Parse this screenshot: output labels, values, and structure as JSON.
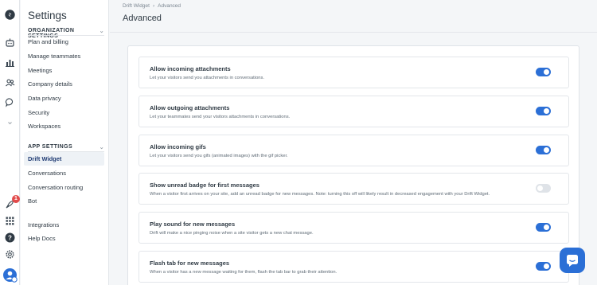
{
  "rail": {
    "icons": [
      "drift-logo-icon",
      "bot-icon",
      "reports-icon",
      "contacts-icon",
      "conversations-icon",
      "more-chevron-icon",
      "rocket-icon",
      "apps-grid-icon",
      "help-icon",
      "settings-icon",
      "avatar-icon"
    ],
    "badge_count": "1"
  },
  "sidebar": {
    "title": "Settings",
    "org_header": "ORGANIZATION SETTINGS",
    "org_items": [
      "Plan and billing",
      "Manage teammates",
      "Meetings",
      "Company details",
      "Data privacy",
      "Security",
      "Workspaces"
    ],
    "app_header": "APP SETTINGS",
    "app_items": [
      "Drift Widget",
      "Conversations",
      "Conversation routing",
      "Bot"
    ],
    "other_items": [
      "Integrations",
      "Help Docs"
    ],
    "active_item": "Drift Widget"
  },
  "breadcrumb": {
    "parent": "Drift Widget",
    "current": "Advanced"
  },
  "page_title": "Advanced",
  "settings": [
    {
      "title": "Allow incoming attachments",
      "desc": "Let your visitors send you attachments in conversations.",
      "enabled": true
    },
    {
      "title": "Allow outgoing attachments",
      "desc": "Let your teammates send your visitors attachments in conversations.",
      "enabled": true
    },
    {
      "title": "Allow incoming gifs",
      "desc": "Let your visitors send you gifs (animated images) with the gif picker.",
      "enabled": true
    },
    {
      "title": "Show unread badge for first messages",
      "desc": "When a visitor first arrives on your site, add an unread badge for new messages. Note: turning this off will likely result in decreased engagement with your Drift Widget.",
      "enabled": false
    },
    {
      "title": "Play sound for new messages",
      "desc": "Drift will make a nice pinging noise when a site visitor gets a new chat message.",
      "enabled": true
    },
    {
      "title": "Flash tab for new messages",
      "desc": "When a visitor has a new message waiting for them, flash the tab bar to grab their attention.",
      "enabled": true
    }
  ],
  "colors": {
    "accent": "#2b6fd6",
    "badge": "#e24c4c",
    "toggle_off": "#dfe3e8"
  }
}
